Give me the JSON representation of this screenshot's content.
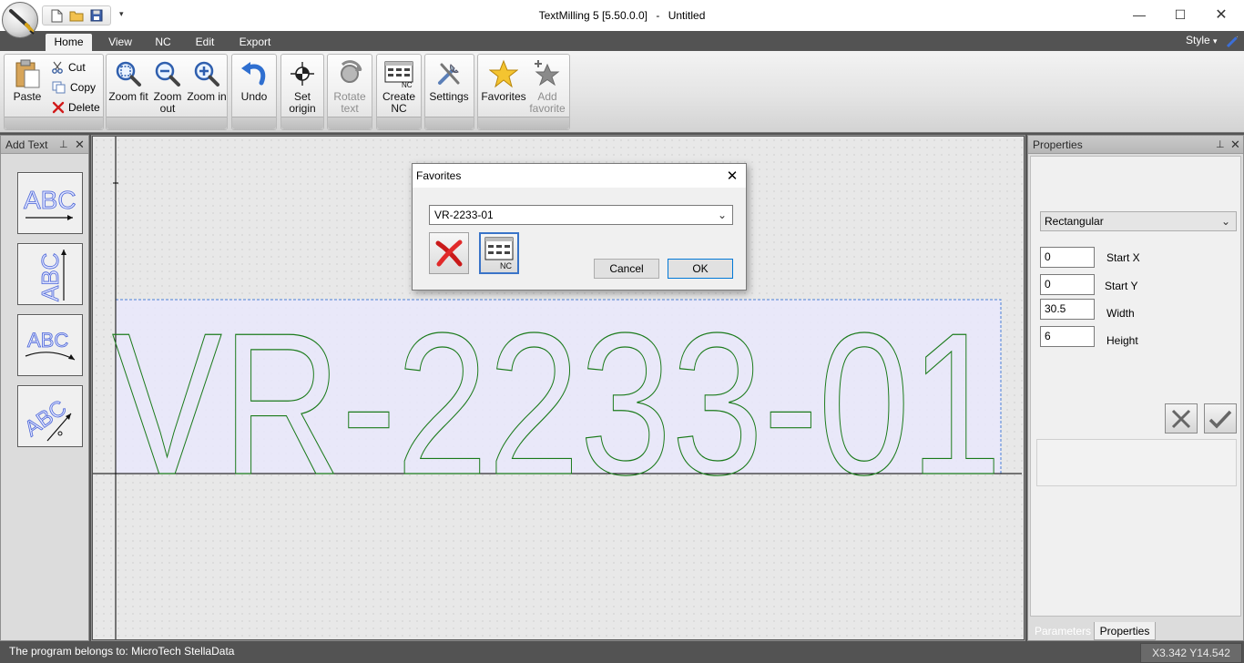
{
  "window": {
    "app_title": "TextMilling 5 [5.50.0.0]",
    "separator": "-",
    "document_title": "Untitled",
    "min_glyph": "—",
    "max_glyph": "☐",
    "close_glyph": "✕"
  },
  "quick_access": {
    "dropdown_glyph": "▾"
  },
  "ribbon": {
    "tabs": [
      {
        "label": "Home",
        "active": true
      },
      {
        "label": "View"
      },
      {
        "label": "NC"
      },
      {
        "label": "Edit"
      },
      {
        "label": "Export"
      }
    ],
    "style_label": "Style",
    "style_glyph": "▾",
    "clipboard": {
      "paste": "Paste",
      "cut": "Cut",
      "copy": "Copy",
      "delete": "Delete"
    },
    "zoom": {
      "fit": "Zoom fit",
      "out": "Zoom out",
      "in": "Zoom in"
    },
    "undo": "Undo",
    "origin": "Set origin",
    "rotate": "Rotate text",
    "create_nc": "Create NC",
    "settings": "Settings",
    "favorites": "Favorites",
    "add_favorite": "Add favorite"
  },
  "left_panel": {
    "title": "Add Text",
    "pin_glyph": "⊥",
    "close_glyph": "✕"
  },
  "canvas": {
    "text": "VR-2233-01",
    "stroke_color": "#1a7a1a",
    "selection_fill": "#e9e8fb",
    "selection_border": "#4a7fd8"
  },
  "right_panel": {
    "title": "Properties",
    "pin_glyph": "⊥",
    "close_glyph": "✕",
    "shape": "Rectangular",
    "shape_glyph": "⌄",
    "fields": [
      {
        "label": "Start X",
        "value": "0"
      },
      {
        "label": "Start Y",
        "value": "0"
      },
      {
        "label": "Width",
        "value": "30.5"
      },
      {
        "label": "Height",
        "value": "6"
      }
    ],
    "tabs": [
      {
        "label": "Parameters"
      },
      {
        "label": "Properties",
        "active": true
      }
    ]
  },
  "status": {
    "text": "The program belongs to: MicroTech StellaData",
    "coords": "X3.342  Y14.542"
  },
  "dialog": {
    "title": "Favorites",
    "close_glyph": "✕",
    "selected": "VR-2233-01",
    "select_glyph": "⌄",
    "nc_label": "NC",
    "cancel": "Cancel",
    "ok": "OK"
  },
  "colors": {
    "accent": "#0078d7",
    "ribbon_dark": "#535353"
  }
}
